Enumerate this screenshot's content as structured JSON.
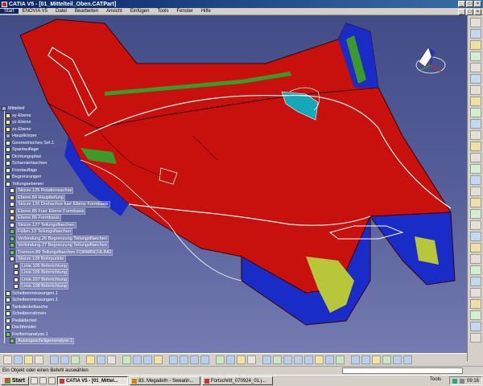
{
  "window": {
    "title": "CATIA V5 - [01_Mittelteil_Oben.CATPart]",
    "controls": [
      "_",
      "□",
      "×"
    ]
  },
  "menu": [
    "Start",
    "ENOVIA V5",
    "Datei",
    "Bearbeiten",
    "Ansicht",
    "Einfügen",
    "Tools",
    "Fenster",
    "Hilfe"
  ],
  "tree": {
    "root": "Mittelteil",
    "items": [
      {
        "label": "xy-Ebene",
        "depth": 1,
        "icon": "plane"
      },
      {
        "label": "yz-Ebene",
        "depth": 1,
        "icon": "plane"
      },
      {
        "label": "zx-Ebene",
        "depth": 1,
        "icon": "plane"
      },
      {
        "label": "Hauptkörper",
        "depth": 1,
        "icon": "body"
      },
      {
        "label": "Geometrisches Set.1",
        "depth": 1,
        "icon": "set"
      },
      {
        "label": "Spantauflage",
        "depth": 1,
        "icon": "set"
      },
      {
        "label": "Dichtungspfad",
        "depth": 1,
        "icon": "set"
      },
      {
        "label": "Scharniertaschen",
        "depth": 1,
        "icon": "set"
      },
      {
        "label": "Frontauflage",
        "depth": 1,
        "icon": "set"
      },
      {
        "label": "Begrenzungen",
        "depth": 1,
        "icon": "set"
      },
      {
        "label": "Teilungsebenen",
        "depth": 1,
        "icon": "set"
      },
      {
        "label": "Skizze.125 Rotationsachse",
        "depth": 2,
        "icon": "sketch"
      },
      {
        "label": "Ebene.84 Hauptteilung",
        "depth": 2,
        "icon": "plane"
      },
      {
        "label": "Skizze.126 Drehachse fuer Ebene Formbasis",
        "depth": 2,
        "icon": "sketch"
      },
      {
        "label": "Ebene.85 Fuer Ebene Formbasis",
        "depth": 2,
        "icon": "plane"
      },
      {
        "label": "Ebene.86 Formbasis",
        "depth": 2,
        "icon": "plane"
      },
      {
        "label": "Skizze.127 Teilungsflaechen",
        "depth": 2,
        "icon": "sketch"
      },
      {
        "label": "Füllen.13 Teilungsflaechen",
        "depth": 2,
        "icon": "surf"
      },
      {
        "label": "Verbindung.26 Begrenzung Teilungsflaechen",
        "depth": 2,
        "icon": "surf"
      },
      {
        "label": "Verbindung.27 Begrenzung Teilungsflaechen",
        "depth": 2,
        "icon": "surf"
      },
      {
        "label": "Trennen.89 Teilungsflaechen FORMRICHLING",
        "depth": 2,
        "icon": "surf"
      },
      {
        "label": "Skizze.128 Bohrpunkte",
        "depth": 2,
        "icon": "sketch"
      },
      {
        "label": "Linie.105 Bohrrichtung",
        "depth": 3,
        "icon": "sketch"
      },
      {
        "label": "Linie.106 Bohrrichtung",
        "depth": 3,
        "icon": "sketch"
      },
      {
        "label": "Linie.107 Bohrrichtung",
        "depth": 3,
        "icon": "sketch"
      },
      {
        "label": "Linie.108 Bohrrichtung",
        "depth": 3,
        "icon": "sketch"
      },
      {
        "label": "Scheibenmessungen.1",
        "depth": 1,
        "icon": "set"
      },
      {
        "label": "Scheibenmessungen.1",
        "depth": 1,
        "icon": "set"
      },
      {
        "label": "Tankdeckeltasche",
        "depth": 1,
        "icon": "set"
      },
      {
        "label": "Scheibenrahmen",
        "depth": 1,
        "icon": "set"
      },
      {
        "label": "Pedaldeckel",
        "depth": 1,
        "icon": "set"
      },
      {
        "label": "Dachfenster",
        "depth": 1,
        "icon": "set"
      },
      {
        "label": "Freiformanalyse.1",
        "depth": 1,
        "icon": "surf"
      },
      {
        "label": "Auszugsschrägenanalyse.1",
        "depth": 2,
        "icon": "surf"
      }
    ]
  },
  "status": {
    "message": "Ein Objekt oder einen Befehl auswählen"
  },
  "taskbar": {
    "start": "Start",
    "tasks": [
      {
        "label": "CATIA V5 - [01_Mittel...",
        "active": true
      },
      {
        "label": "83. Megadeth - Sweatin...",
        "active": false
      },
      {
        "label": "Fortschritt_070924_01.j...",
        "active": false
      }
    ],
    "tools_label": "Tools",
    "clock": "09:16"
  },
  "colors": {
    "viewport_top": "#424c86",
    "viewport_bottom": "#737bb0",
    "part_red": "#c8100c",
    "part_blue": "#1a2cc8",
    "part_green": "#3c9a2a",
    "part_yellow": "#b8c63a"
  }
}
